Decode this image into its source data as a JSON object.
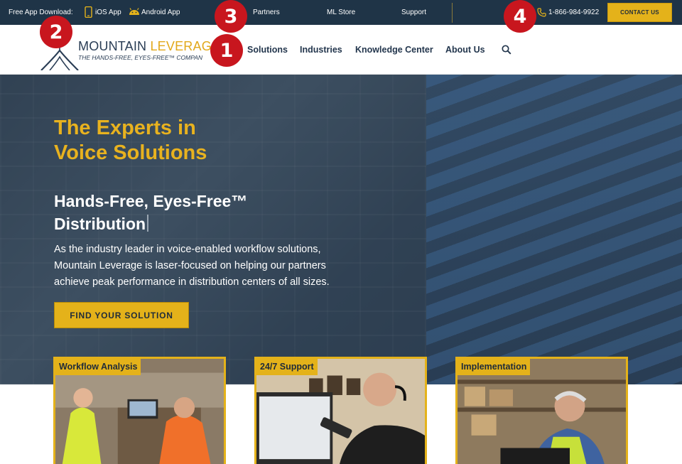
{
  "topbar": {
    "app_download_label": "Free App Download:",
    "ios_label": "iOS App",
    "android_label": "Android App",
    "links": [
      "Partners",
      "ML Store",
      "Support"
    ],
    "phone": "1-866-984-9922",
    "contact_label": "CONTACT US"
  },
  "logo": {
    "name_part1": "MOUNTAIN ",
    "name_part2": "LEVERAG",
    "tagline": "THE HANDS-FREE, EYES-FREE™ COMPAN"
  },
  "nav": {
    "items": [
      "Solutions",
      "Industries",
      "Knowledge Center",
      "About Us"
    ],
    "search_icon": "search-icon"
  },
  "hero": {
    "title_line1": "The Experts in",
    "title_line2": "Voice Solutions",
    "subtitle_line1": "Hands-Free, Eyes-Free™",
    "subtitle_line2": "Distribution",
    "body_line1": "As the industry leader in voice-enabled workflow solutions,",
    "body_line2": "Mountain Leverage is laser-focused on helping our partners",
    "body_line3": "achieve peak performance in distribution centers of all sizes.",
    "cta_label": "FIND YOUR SOLUTION"
  },
  "cards": [
    {
      "label": "Workflow Analysis"
    },
    {
      "label": "24/7 Support"
    },
    {
      "label": "Implementation"
    }
  ],
  "badges": [
    "1",
    "2",
    "3",
    "4"
  ],
  "colors": {
    "topbar_bg": "#1f3447",
    "accent_gold": "#e4b21a",
    "navy_text": "#23364d",
    "badge_red": "#c8161e"
  }
}
